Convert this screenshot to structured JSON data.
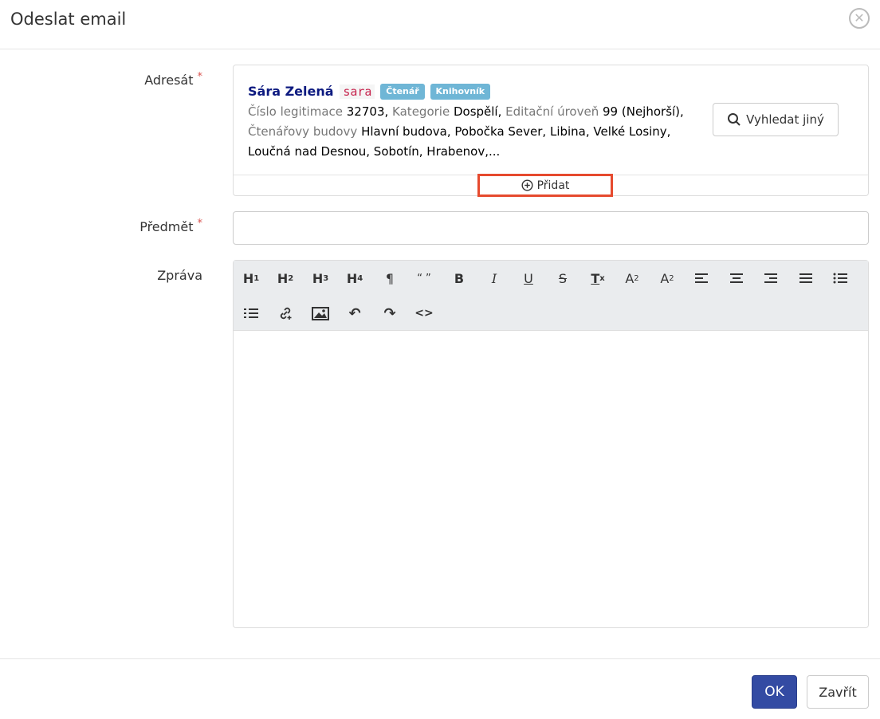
{
  "dialog": {
    "title": "Odeslat email"
  },
  "recipient": {
    "label": "Adresát",
    "required_mark": "*",
    "name": "Sára Zelená",
    "login": "sara",
    "badges": [
      "Čtenář",
      "Knihovník"
    ],
    "fields": {
      "card_label": "Číslo legitimace",
      "card_value": "32703,",
      "category_label": "Kategorie",
      "category_value": "Dospělí,",
      "edit_label": "Editační úroveň",
      "edit_value": "99 (Nejhorší),",
      "buildings_label": "Čtenářovy budovy",
      "buildings_line1": "Hlavní budova, Pobočka Sever, Libina, Velké Losiny,",
      "buildings_line2": "Loučná nad Desnou, Sobotín, Hrabenov,..."
    },
    "search_button": "Vyhledat jiný",
    "add_button": "Přidat"
  },
  "subject": {
    "label": "Předmět",
    "required_mark": "*",
    "value": ""
  },
  "message": {
    "label": "Zpráva",
    "toolbar": {
      "h1": "H",
      "h1_sub": "1",
      "h2": "H",
      "h2_sub": "2",
      "h3": "H",
      "h3_sub": "3",
      "h4": "H",
      "h4_sub": "4",
      "paragraph": "¶",
      "quote": "“ ”",
      "bold": "B",
      "italic": "I",
      "underline": "U",
      "strike": "S",
      "clear": "T",
      "clear_sub": "x",
      "sup": "A",
      "sup_mark": "2",
      "sub": "A",
      "sub_mark": "2",
      "undo": "↶",
      "redo": "↷",
      "code": "<>"
    }
  },
  "footer": {
    "ok": "OK",
    "close": "Zavřít"
  }
}
